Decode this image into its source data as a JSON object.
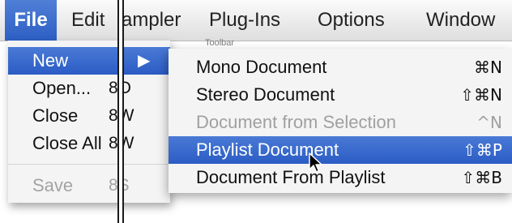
{
  "menubar": {
    "items": [
      {
        "label": "File"
      },
      {
        "label": "Edit"
      },
      {
        "label": "ampler"
      },
      {
        "label": "Plug-Ins"
      },
      {
        "label": "Options"
      },
      {
        "label": "Window"
      }
    ]
  },
  "file_menu": {
    "items": [
      {
        "label": "New",
        "shortcut": "",
        "arrow": "▶",
        "state": "highlighted"
      },
      {
        "label": "Open...",
        "shortcut": "8O",
        "state": "enabled"
      },
      {
        "label": "Close",
        "shortcut": "8W",
        "state": "enabled"
      },
      {
        "label": "Close All",
        "shortcut": "8W",
        "state": "enabled"
      },
      {
        "label": "Save",
        "shortcut": "8S",
        "state": "disabled"
      }
    ]
  },
  "submenu": {
    "label_overlay": "Toolbar",
    "items": [
      {
        "label": "Mono Document",
        "shortcut": "⌘N",
        "state": "enabled"
      },
      {
        "label": "Stereo Document",
        "shortcut": "⇧⌘N",
        "state": "enabled"
      },
      {
        "label": "Document from Selection",
        "shortcut": "^N",
        "state": "disabled"
      },
      {
        "label": "Playlist Document",
        "shortcut": "⇧⌘P",
        "state": "highlighted"
      },
      {
        "label": "Document From Playlist",
        "shortcut": "⇧⌘B",
        "state": "enabled"
      }
    ]
  },
  "colors": {
    "highlight": "#2d5fc4",
    "menu_bg": "#f4f4f4",
    "disabled_text": "#a0a0a0"
  }
}
